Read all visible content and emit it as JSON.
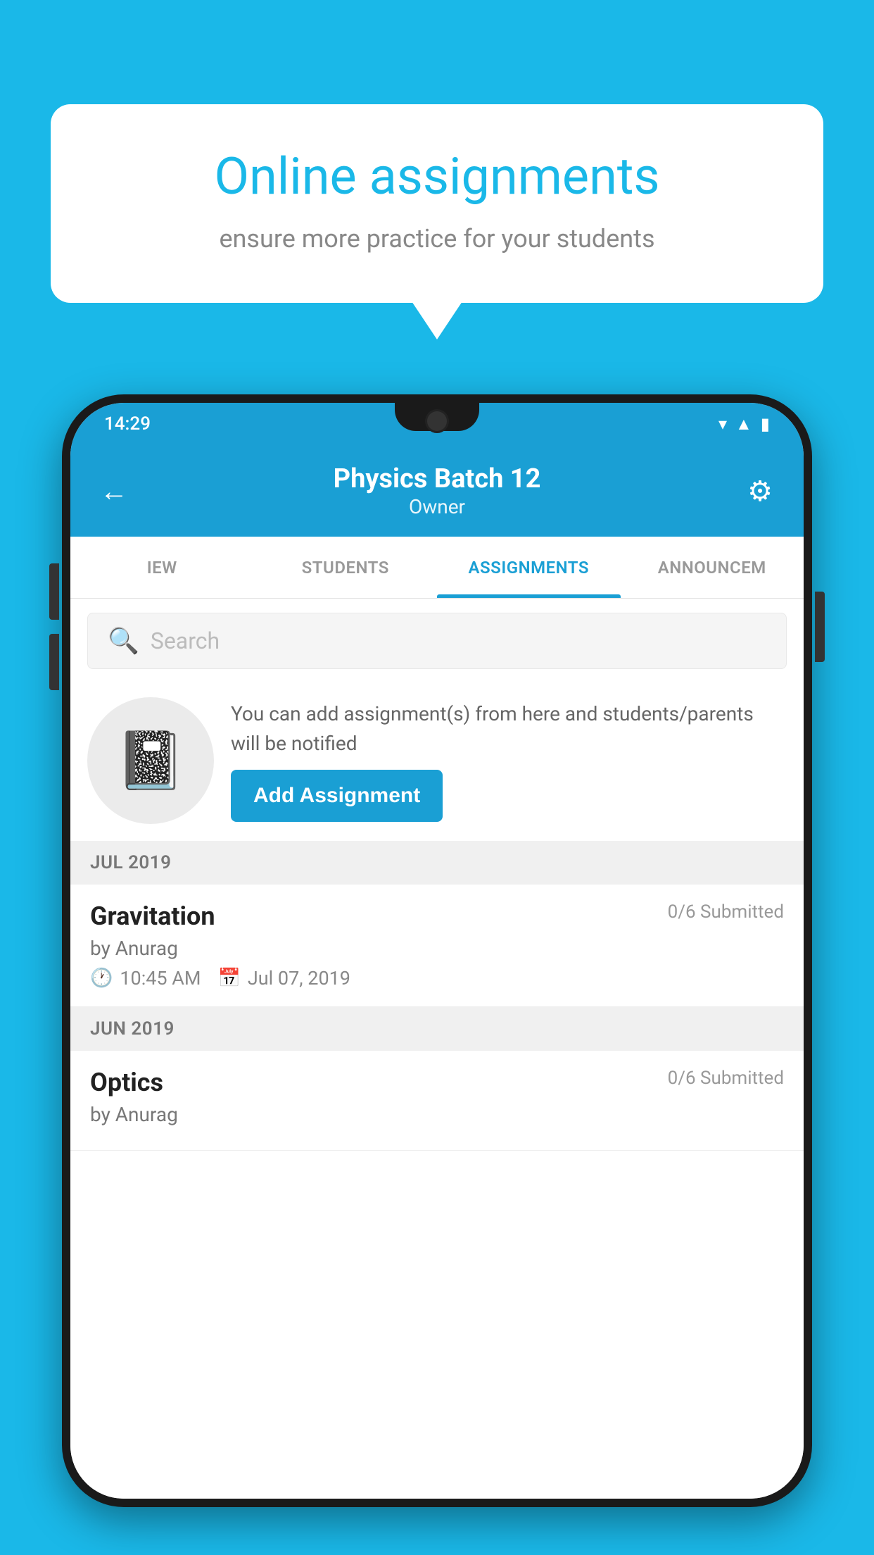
{
  "background_color": "#1ab8e8",
  "speech_bubble": {
    "title": "Online assignments",
    "subtitle": "ensure more practice for your students"
  },
  "phone": {
    "status_bar": {
      "time": "14:29",
      "icons": [
        "wifi",
        "signal",
        "battery"
      ]
    },
    "app_bar": {
      "title": "Physics Batch 12",
      "subtitle": "Owner",
      "back_label": "←",
      "settings_label": "⚙"
    },
    "tabs": [
      {
        "label": "IEW",
        "active": false
      },
      {
        "label": "STUDENTS",
        "active": false
      },
      {
        "label": "ASSIGNMENTS",
        "active": true
      },
      {
        "label": "ANNOUNCEM",
        "active": false
      }
    ],
    "search": {
      "placeholder": "Search"
    },
    "promo": {
      "description": "You can add assignment(s) from here and students/parents will be notified",
      "button_label": "Add Assignment"
    },
    "sections": [
      {
        "month_label": "JUL 2019",
        "assignments": [
          {
            "name": "Gravitation",
            "submitted": "0/6 Submitted",
            "by": "by Anurag",
            "time": "10:45 AM",
            "date": "Jul 07, 2019"
          }
        ]
      },
      {
        "month_label": "JUN 2019",
        "assignments": [
          {
            "name": "Optics",
            "submitted": "0/6 Submitted",
            "by": "by Anurag",
            "time": "",
            "date": ""
          }
        ]
      }
    ]
  }
}
